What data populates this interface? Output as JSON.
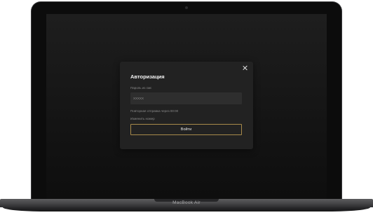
{
  "device": {
    "brand_label": "MacBook Air"
  },
  "modal": {
    "title": "Авторизация",
    "close_icon": "close-icon",
    "code_field": {
      "label": "Пароль из смс",
      "value": "",
      "placeholder": "XXXXX"
    },
    "resend_text": "Повторная отправка через 00:00",
    "change_number_link": "Изменить номер",
    "submit_label": "Войти"
  },
  "colors": {
    "accent_border": "#a88a4a",
    "modal_bg": "#222222",
    "input_bg": "#2e2e2e"
  }
}
